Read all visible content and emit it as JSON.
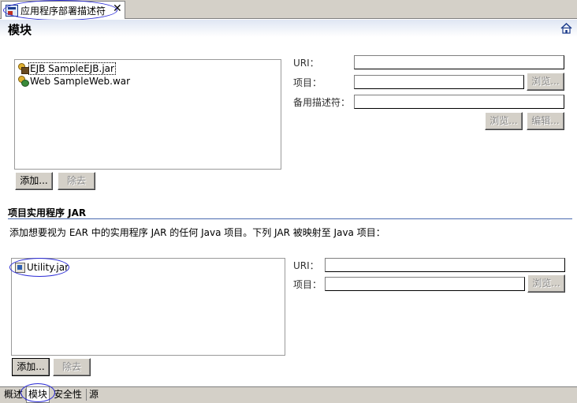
{
  "editor_tab": {
    "title": "应用程序部署描述符",
    "close": "✕"
  },
  "page_title": "模块",
  "icons": {
    "home": "home-icon",
    "tab": "deployment-descriptor-icon",
    "ejb": "ejb-module-icon",
    "war": "web-module-icon",
    "jar": "jar-icon"
  },
  "modules": {
    "items": [
      "EJB SampleEJB.jar",
      "Web SampleWeb.war"
    ],
    "add_label": "添加...",
    "remove_label": "除去",
    "uri_label": "URI：",
    "project_label": "项目：",
    "alt_dd_label": "备用描述符：",
    "uri_value": "",
    "project_value": "",
    "alt_dd_value": "",
    "browse_label": "浏览...",
    "alt_browse_label": "浏览...",
    "edit_label": "编辑..."
  },
  "utility": {
    "section_title": "项目实用程序 JAR",
    "description": "添加想要视为 EAR 中的实用程序 JAR 的任何 Java 项目。下列 JAR 被映射至 Java 项目：",
    "items": [
      "Utility.jar"
    ],
    "add_label": "添加...",
    "remove_label": "除去",
    "uri_label": "URI：",
    "project_label": "项目：",
    "uri_value": "",
    "project_value": "",
    "browse_label": "浏览..."
  },
  "page_tabs": [
    "概述",
    "模块",
    "安全性",
    "源"
  ],
  "active_page_tab": "模块",
  "colors": {
    "annotation": "#2b2bd6",
    "section_rule": "#4a6ab0",
    "chrome": "#d4d0c8"
  }
}
